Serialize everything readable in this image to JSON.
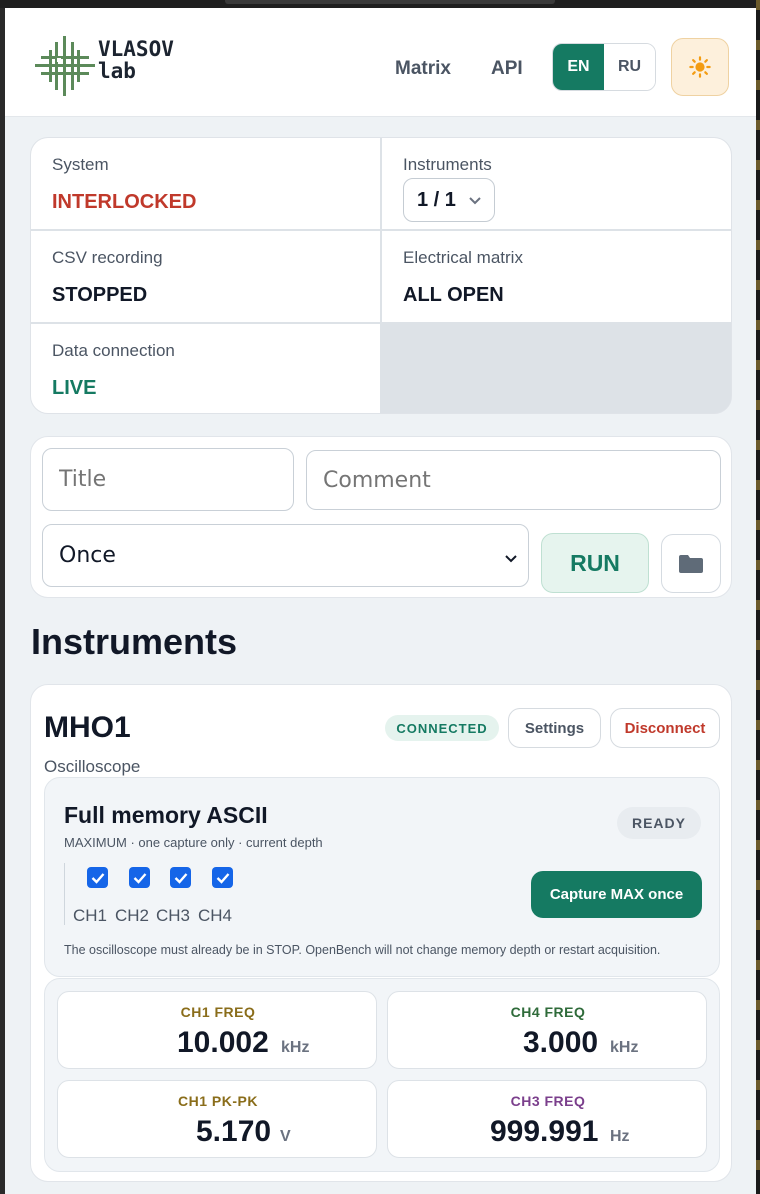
{
  "header": {
    "logo_text_line1": "VLASOV",
    "logo_text_line2": "lab",
    "nav": [
      {
        "label": "Matrix"
      },
      {
        "label": "API"
      }
    ],
    "languages": [
      {
        "label": "EN",
        "active": true
      },
      {
        "label": "RU",
        "active": false
      }
    ],
    "theme_icon": "sun-icon"
  },
  "status": {
    "system_label": "System",
    "system_value": "INTERLOCKED",
    "instruments_label": "Instruments",
    "instruments_value": "1 / 1",
    "csv_label": "CSV recording",
    "csv_value": "STOPPED",
    "matrix_label": "Electrical matrix",
    "matrix_value": "ALL OPEN",
    "data_label": "Data connection",
    "data_value": "LIVE"
  },
  "run": {
    "title_placeholder": "Title",
    "comment_placeholder": "Comment",
    "mode_value": "Once",
    "run_label": "RUN",
    "folder_icon": "folder-icon"
  },
  "section_title": "Instruments",
  "instrument": {
    "name": "MHO1",
    "type": "Oscilloscope",
    "status_badge": "CONNECTED",
    "settings_label": "Settings",
    "disconnect_label": "Disconnect",
    "capture": {
      "title": "Full memory ASCII",
      "subtitle": "MAXIMUM · one capture only · current depth",
      "badge": "READY",
      "channels": [
        {
          "label": "CH1",
          "checked": true
        },
        {
          "label": "CH2",
          "checked": true
        },
        {
          "label": "CH3",
          "checked": true
        },
        {
          "label": "CH4",
          "checked": true
        }
      ],
      "button_label": "Capture MAX once",
      "note": "The oscilloscope must already be in STOP. OpenBench will not change memory depth or restart acquisition."
    },
    "measurements": [
      {
        "label": "CH1 FREQ",
        "value": "10.002",
        "unit": "kHz",
        "color": "#8a6d1a"
      },
      {
        "label": "CH4 FREQ",
        "value": "3.000",
        "unit": "kHz",
        "color": "#2f6b3a"
      },
      {
        "label": "CH1 PK-PK",
        "value": "5.170",
        "unit": "V",
        "color": "#8a6d1a"
      },
      {
        "label": "CH3 FREQ",
        "value": "999.991",
        "unit": "Hz",
        "color": "#7b3f8c"
      }
    ]
  },
  "colors": {
    "accent": "#157a62",
    "danger": "#c0392b",
    "checkbox": "#1565e8"
  }
}
